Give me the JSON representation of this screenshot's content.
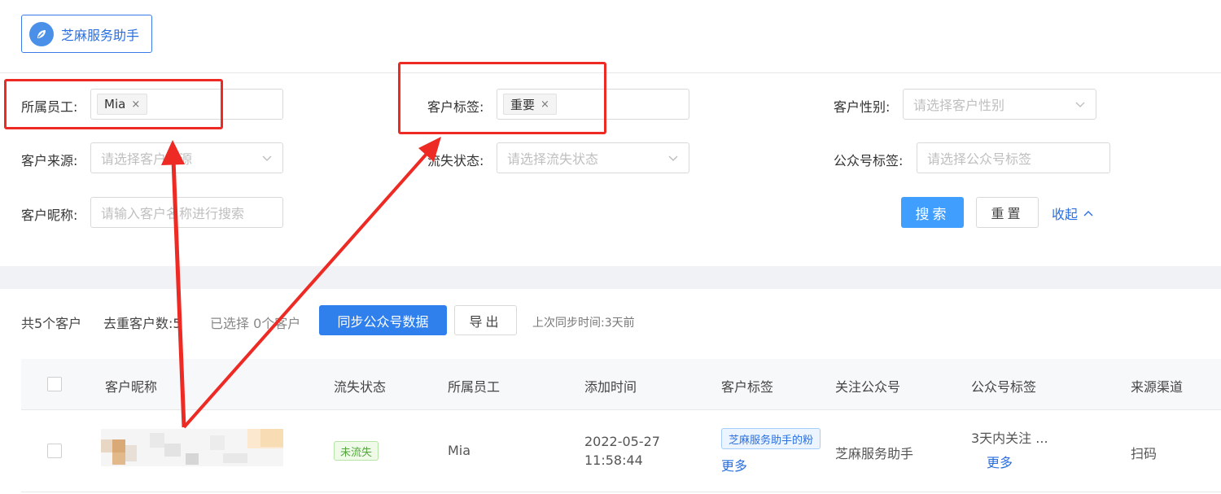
{
  "app": {
    "name": "芝麻服务助手",
    "logo_icon": "leaf-icon"
  },
  "filters": {
    "staff": {
      "label": "所属员工:",
      "tag": "Mia",
      "remove": "×"
    },
    "customer_tag": {
      "label": "客户标签:",
      "tag": "重要",
      "remove": "×"
    },
    "gender": {
      "label": "客户性别:",
      "placeholder": "请选择客户性别"
    },
    "source": {
      "label": "客户来源:",
      "placeholder": "请选择客户来源"
    },
    "churn": {
      "label": "流失状态:",
      "placeholder": "请选择流失状态"
    },
    "mp_tag": {
      "label": "公众号标签:",
      "placeholder": "请选择公众号标签"
    },
    "nickname": {
      "label": "客户昵称:",
      "placeholder": "请输入客户名称进行搜索"
    },
    "search_label": "搜索",
    "reset_label": "重置",
    "collapse_label": "收起"
  },
  "summary": {
    "total": "共5个客户",
    "dedup": "去重客户数:5",
    "selected": "已选择 0个客户",
    "sync_label": "同步公众号数据",
    "export_label": "导出",
    "last_sync": "上次同步时间:3天前"
  },
  "table": {
    "columns": [
      "客户昵称",
      "流失状态",
      "所属员工",
      "添加时间",
      "客户标签",
      "关注公众号",
      "公众号标签",
      "来源渠道"
    ],
    "rows": [
      {
        "status": "未流失",
        "staff": "Mia",
        "added_date": "2022-05-27",
        "added_time": "11:58:44",
        "customer_tag": "芝麻服务助手的粉",
        "tag_more": "更多",
        "mp_account": "芝麻服务助手",
        "mp_tag": "3天内关注 ...",
        "mp_tag_more": "更多",
        "source": "扫码"
      }
    ]
  },
  "colors": {
    "accent": "#409eff",
    "annotation": "#ee2a24"
  }
}
